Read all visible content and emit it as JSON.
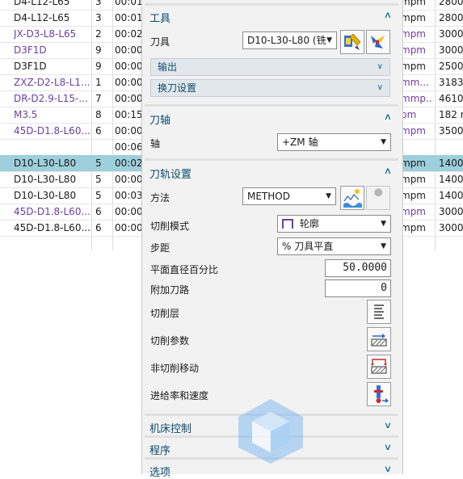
{
  "table": {
    "rows": [
      {
        "name": "D4-L12-L65",
        "num": "3",
        "time": "00:01",
        "speed": "mpm",
        "rpm": "2800",
        "color": "dark"
      },
      {
        "name": "D4-L12-L65",
        "num": "3",
        "time": "00:01",
        "speed": "mpm",
        "rpm": "2800",
        "color": "dark"
      },
      {
        "name": "JX-D3-L8-L65",
        "num": "2",
        "time": "00:02",
        "speed": "mpm",
        "rpm": "3000",
        "color": "purple"
      },
      {
        "name": "D3F1D",
        "num": "9",
        "time": "00:00",
        "speed": "mpm",
        "rpm": "3000",
        "color": "purple"
      },
      {
        "name": "D3F1D",
        "num": "9",
        "time": "00:00",
        "speed": "mpm",
        "rpm": "2500",
        "color": "dark"
      },
      {
        "name": "ZXZ-D2-L8-L1...",
        "num": "1",
        "time": "00:00",
        "speed": "mm...",
        "rpm": "3183",
        "color": "purple"
      },
      {
        "name": "DR-D2.9-L15-...",
        "num": "7",
        "time": "00:00",
        "speed": "mmp...",
        "rpm": "4610",
        "color": "purple"
      },
      {
        "name": "M3.5",
        "num": "8",
        "time": "00:15",
        "speed": "pm",
        "rpm": "182 r",
        "color": "purple"
      },
      {
        "name": "45D-D1.8-L60...",
        "num": "6",
        "time": "00:00",
        "speed": "mpm",
        "rpm": "3500",
        "color": "purple"
      },
      {
        "name": "",
        "num": "",
        "time": "00:06",
        "speed": "",
        "rpm": "",
        "color": "dark"
      },
      {
        "name": "D10-L30-L80",
        "num": "5",
        "time": "00:02",
        "speed": "mpm",
        "rpm": "1400",
        "color": "dark"
      },
      {
        "name": "D10-L30-L80",
        "num": "5",
        "time": "00:00",
        "speed": "mpm",
        "rpm": "1400",
        "color": "dark"
      },
      {
        "name": "D10-L30-L80",
        "num": "5",
        "time": "00:03",
        "speed": "mpm",
        "rpm": "1400",
        "color": "dark"
      },
      {
        "name": "45D-D1.8-L60...",
        "num": "6",
        "time": "00:00",
        "speed": "mpm",
        "rpm": "3000",
        "color": "purple"
      },
      {
        "name": "45D-D1.8-L60...",
        "num": "6",
        "time": "00:00",
        "speed": "mpm",
        "rpm": "3000",
        "color": "dark"
      }
    ]
  },
  "dialog": {
    "tool": {
      "title": "工具",
      "tool_label": "刀具",
      "tool_value": "D10-L30-L80 (铣",
      "output_label": "输出",
      "tool_change_label": "换刀设置"
    },
    "axis": {
      "title": "刀轴",
      "axis_label": "轴",
      "axis_value": "+ZM 轴"
    },
    "path": {
      "title": "刀轨设置",
      "method_label": "方法",
      "method_value": "METHOD",
      "cut_pattern_label": "切削模式",
      "cut_pattern_value": "轮廓",
      "stepover_label": "步距",
      "stepover_value": "% 刀具平直",
      "percent_label": "平面直径百分比",
      "percent_value": "50.0000",
      "extra_passes_label": "附加刀路",
      "extra_passes_value": "0",
      "cut_levels_label": "切削层",
      "cut_params_label": "切削参数",
      "non_cut_label": "非切削移动",
      "feeds_label": "进给率和速度"
    },
    "machine_title": "机床控制",
    "program_title": "程序",
    "options_title": "选项"
  },
  "colors": {
    "selected_row": "#9ecfdc",
    "group_title": "#0b4d6e",
    "purple_text": "#6b3fa0"
  }
}
